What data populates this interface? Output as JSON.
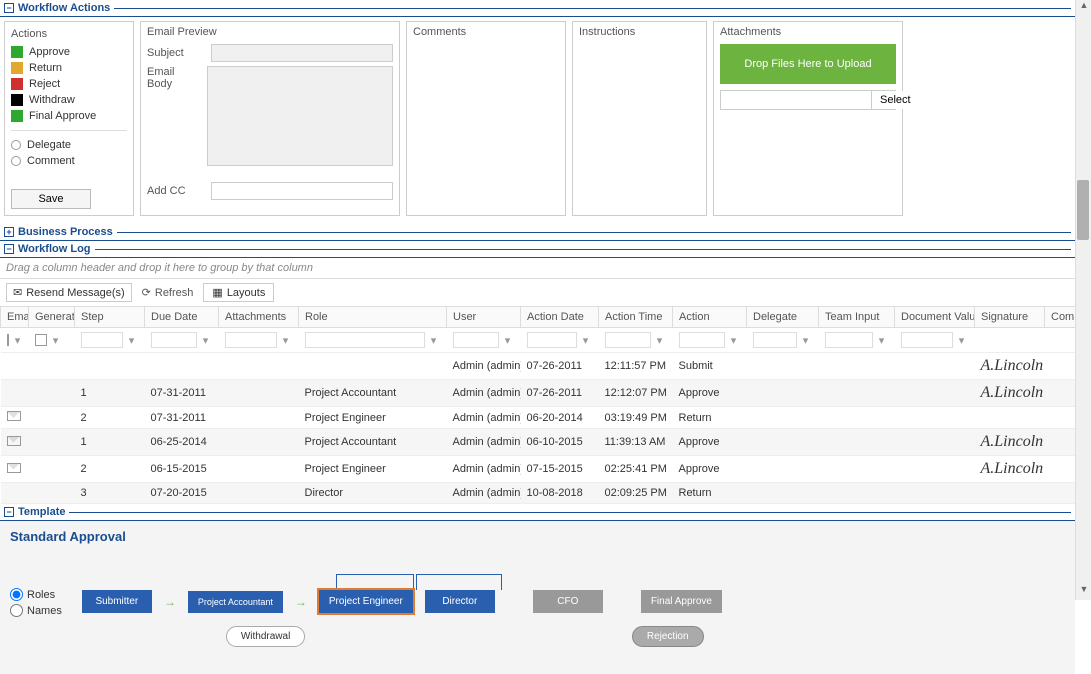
{
  "sections": {
    "workflow_actions": "Workflow Actions",
    "business_process": "Business Process",
    "workflow_log": "Workflow Log",
    "template": "Template"
  },
  "actions_panel": {
    "label": "Actions",
    "items": [
      {
        "label": "Approve",
        "color": "#2fa82f"
      },
      {
        "label": "Return",
        "color": "#e0a82f"
      },
      {
        "label": "Reject",
        "color": "#d02f2f"
      },
      {
        "label": "Withdraw",
        "color": "#000000"
      },
      {
        "label": "Final Approve",
        "color": "#2fa82f"
      }
    ],
    "extra": [
      "Delegate",
      "Comment"
    ],
    "save": "Save"
  },
  "email_panel": {
    "label": "Email Preview",
    "subject_label": "Subject",
    "body_label": "Email Body",
    "addcc_label": "Add CC"
  },
  "comments_panel": {
    "label": "Comments"
  },
  "instructions_panel": {
    "label": "Instructions"
  },
  "attachments_panel": {
    "label": "Attachments",
    "drop": "Drop Files Here to Upload",
    "select": "Select"
  },
  "log": {
    "group_hint": "Drag a column header and drop it here to group by that column",
    "resend": "Resend Message(s)",
    "refresh": "Refresh",
    "layouts": "Layouts",
    "cols": {
      "email": "Email",
      "generated": "Generated",
      "step": "Step",
      "due": "Due Date",
      "attachments": "Attachments",
      "role": "Role",
      "user": "User",
      "action_date": "Action Date",
      "action_time": "Action Time",
      "action": "Action",
      "delegate": "Delegate",
      "team_input": "Team Input",
      "doc_value": "Document Value",
      "signature": "Signature",
      "comments": "Comm"
    },
    "rows": [
      {
        "email": "",
        "step": "",
        "due": "",
        "role": "",
        "user": "Admin (admin)",
        "adate": "07-26-2011",
        "atime": "12:11:57 PM",
        "action": "Submit",
        "sig": "A.Lincoln"
      },
      {
        "email": "",
        "step": "1",
        "due": "07-31-2011",
        "role": "Project Accountant",
        "user": "Admin (admin)",
        "adate": "07-26-2011",
        "atime": "12:12:07 PM",
        "action": "Approve",
        "sig": "A.Lincoln"
      },
      {
        "email": "y",
        "step": "2",
        "due": "07-31-2011",
        "role": "Project Engineer",
        "user": "Admin (admin)",
        "adate": "06-20-2014",
        "atime": "03:19:49 PM",
        "action": "Return",
        "sig": ""
      },
      {
        "email": "y",
        "step": "1",
        "due": "06-25-2014",
        "role": "Project Accountant",
        "user": "Admin (admin)",
        "adate": "06-10-2015",
        "atime": "11:39:13 AM",
        "action": "Approve",
        "sig": "A.Lincoln"
      },
      {
        "email": "y",
        "step": "2",
        "due": "06-15-2015",
        "role": "Project Engineer",
        "user": "Admin (admin)",
        "adate": "07-15-2015",
        "atime": "02:25:41 PM",
        "action": "Approve",
        "sig": "A.Lincoln"
      },
      {
        "email": "",
        "step": "3",
        "due": "07-20-2015",
        "role": "Director",
        "user": "Admin (admin)",
        "adate": "10-08-2018",
        "atime": "02:09:25 PM",
        "action": "Return",
        "sig": ""
      }
    ]
  },
  "template": {
    "title": "Standard Approval",
    "radio_roles": "Roles",
    "radio_names": "Names",
    "nodes": {
      "submitter": "Submitter",
      "pa": "Project Accountant",
      "pe": "Project Engineer",
      "director": "Director",
      "cfo": "CFO",
      "final": "Final Approve"
    },
    "withdrawal": "Withdrawal",
    "rejection": "Rejection"
  }
}
